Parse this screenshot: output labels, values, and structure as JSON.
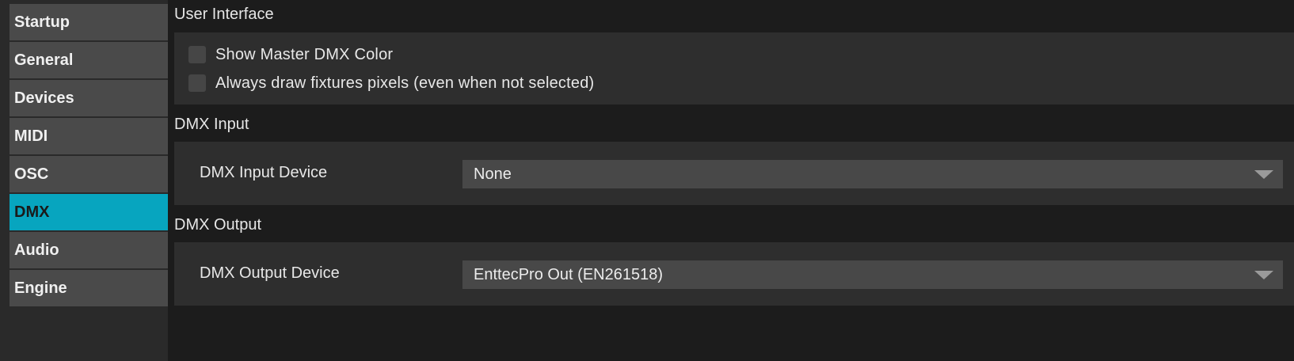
{
  "sidebar": {
    "items": [
      {
        "label": "Startup"
      },
      {
        "label": "General"
      },
      {
        "label": "Devices"
      },
      {
        "label": "MIDI"
      },
      {
        "label": "OSC"
      },
      {
        "label": "DMX"
      },
      {
        "label": "Audio"
      },
      {
        "label": "Engine"
      }
    ],
    "active": "DMX"
  },
  "user_interface": {
    "title": "User Interface",
    "show_master_dmx_color": {
      "label": "Show Master DMX Color",
      "checked": false
    },
    "always_draw_pixels": {
      "label": "Always draw fixtures pixels (even when not selected)",
      "checked": false
    }
  },
  "dmx_input": {
    "title": "DMX Input",
    "device_label": "DMX Input Device",
    "device_value": "None"
  },
  "dmx_output": {
    "title": "DMX Output",
    "device_label": "DMX Output Device",
    "device_value": "EnttecPro Out (EN261518)"
  },
  "colors": {
    "accent": "#07a5bf",
    "sidebar_item": "#4a4a4a",
    "panel": "#2e2e2e",
    "background": "#1c1c1c"
  }
}
